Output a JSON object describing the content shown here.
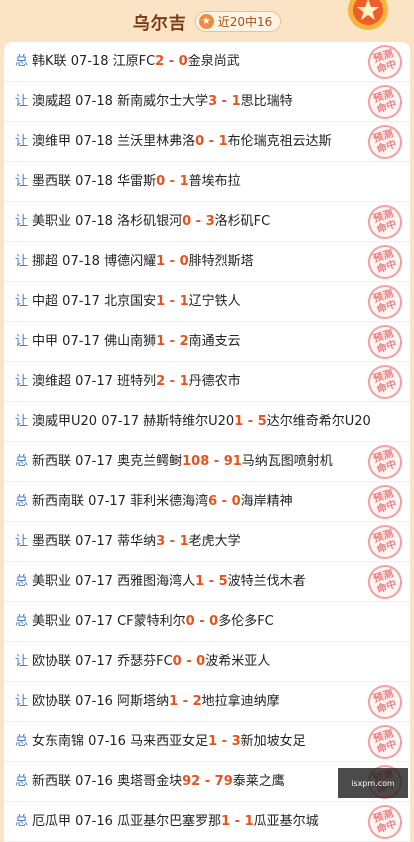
{
  "header": {
    "title": "乌尔吉",
    "record": "近20中16"
  },
  "stamp_text": [
    "预测",
    "命中"
  ],
  "watermark": {
    "line1": "",
    "line2": "isxpm.com"
  },
  "rows": [
    {
      "tag": "总",
      "league": "韩K联",
      "date": "07-18",
      "home": "江原FC",
      "hs": "2",
      "as": "0",
      "away": "金泉尚武",
      "hit": true
    },
    {
      "tag": "让",
      "league": "澳威超",
      "date": "07-18",
      "home": "新南威尔士大学",
      "hs": "3",
      "as": "1",
      "away": "思比瑞特",
      "hit": true
    },
    {
      "tag": "让",
      "league": "澳维甲",
      "date": "07-18",
      "home": "兰沃里林弗洛",
      "hs": "0",
      "as": "1",
      "away": "布伦瑞克祖云达斯",
      "hit": true
    },
    {
      "tag": "让",
      "league": "墨西联",
      "date": "07-18",
      "home": "华雷斯",
      "hs": "0",
      "as": "1",
      "away": "普埃布拉",
      "hit": false
    },
    {
      "tag": "让",
      "league": "美职业",
      "date": "07-18",
      "home": "洛杉矶银河",
      "hs": "0",
      "as": "3",
      "away": "洛杉矶FC",
      "hit": true
    },
    {
      "tag": "让",
      "league": "挪超",
      "date": "07-18",
      "home": "博德闪耀",
      "hs": "1",
      "as": "0",
      "away": "腓特烈斯塔",
      "hit": true
    },
    {
      "tag": "让",
      "league": "中超",
      "date": "07-17",
      "home": "北京国安",
      "hs": "1",
      "as": "1",
      "away": "辽宁铁人",
      "hit": true
    },
    {
      "tag": "让",
      "league": "中甲",
      "date": "07-17",
      "home": "佛山南狮",
      "hs": "1",
      "as": "2",
      "away": "南通支云",
      "hit": true
    },
    {
      "tag": "让",
      "league": "澳维超",
      "date": "07-17",
      "home": "班特列",
      "hs": "2",
      "as": "1",
      "away": "丹德农市",
      "hit": true
    },
    {
      "tag": "让",
      "league": "澳威甲U20",
      "date": "07-17",
      "home": "赫斯特维尔U20",
      "hs": "1",
      "as": "5",
      "away": "达尔维奇希尔U20",
      "hit": false,
      "wrap": true
    },
    {
      "tag": "总",
      "league": "新西联",
      "date": "07-17",
      "home": "奥克兰鳄鲥",
      "hs": "108",
      "as": "91",
      "away": "马纳瓦图喷射机",
      "hit": true
    },
    {
      "tag": "总",
      "league": "新西南联",
      "date": "07-17",
      "home": "菲利米德海湾",
      "hs": "6",
      "as": "0",
      "away": "海岸精神",
      "hit": true
    },
    {
      "tag": "让",
      "league": "墨西联",
      "date": "07-17",
      "home": "蒂华纳",
      "hs": "3",
      "as": "1",
      "away": "老虎大学",
      "hit": true
    },
    {
      "tag": "总",
      "league": "美职业",
      "date": "07-17",
      "home": "西雅图海湾人",
      "hs": "1",
      "as": "5",
      "away": "波特兰伐木者",
      "hit": true
    },
    {
      "tag": "总",
      "league": "美职业",
      "date": "07-17",
      "home": "CF蒙特利尔",
      "hs": "0",
      "as": "0",
      "away": "多伦多FC",
      "hit": false
    },
    {
      "tag": "让",
      "league": "欧协联",
      "date": "07-17",
      "home": "乔瑟芬FC",
      "hs": "0",
      "as": "0",
      "away": "波希米亚人",
      "hit": false
    },
    {
      "tag": "让",
      "league": "欧协联",
      "date": "07-16",
      "home": "阿斯塔纳",
      "hs": "1",
      "as": "2",
      "away": "地拉拿迪纳摩",
      "hit": true
    },
    {
      "tag": "总",
      "league": "女东南锦",
      "date": "07-16",
      "home": "马来西亚女足",
      "hs": "1",
      "as": "3",
      "away": "新加坡女足",
      "hit": true
    },
    {
      "tag": "总",
      "league": "新西联",
      "date": "07-16",
      "home": "奥塔哥金块",
      "hs": "92",
      "as": "79",
      "away": "泰莱之鹰",
      "hit": true
    },
    {
      "tag": "总",
      "league": "厄瓜甲",
      "date": "07-16",
      "home": "瓜亚基尔巴塞罗那",
      "hs": "1",
      "as": "1",
      "away": "瓜亚基尔城",
      "hit": true
    }
  ]
}
